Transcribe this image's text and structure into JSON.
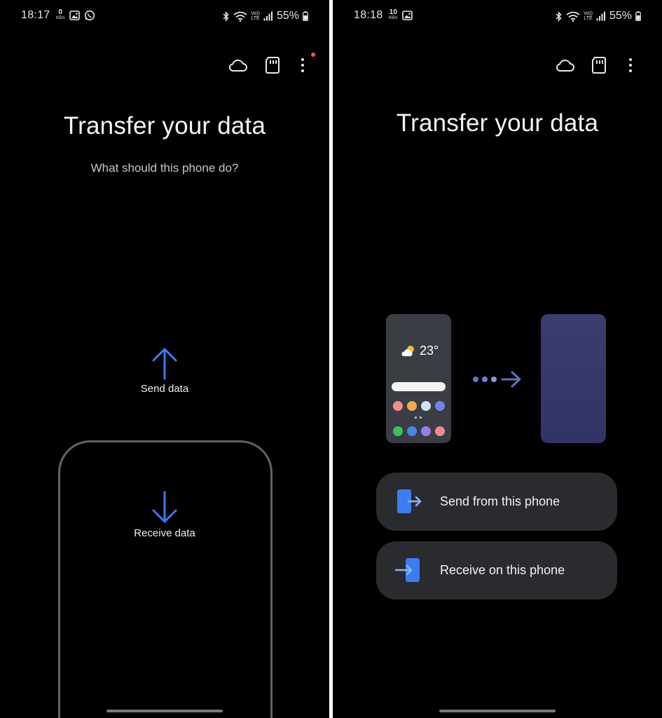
{
  "left_screen": {
    "status_bar": {
      "time": "18:17",
      "speed_value": "0",
      "speed_unit": "KB/s",
      "battery": "55%",
      "volte_top": "Vo))",
      "volte_bottom": "LTE"
    },
    "title": "Transfer your data",
    "subtitle": "What should this phone do?",
    "send_label": "Send data",
    "receive_label": "Receive data"
  },
  "right_screen": {
    "status_bar": {
      "time": "18:18",
      "speed_value": "10",
      "speed_unit": "KB/s",
      "battery": "55%",
      "volte_top": "Vo))",
      "volte_bottom": "LTE"
    },
    "title": "Transfer your data",
    "illustration": {
      "temperature": "23°"
    },
    "send_option": "Send from this phone",
    "receive_option": "Receive on this phone"
  },
  "colors": {
    "accent_blue": "#3d7cf0",
    "notification_dot": "#ff5a36",
    "card_bg": "#2a2b2f",
    "outline_gray": "#5e626a"
  },
  "icons": [
    "cloud-icon",
    "sd-card-icon",
    "more-vert-icon",
    "bluetooth-icon",
    "wifi-icon",
    "signal-icon",
    "battery-icon",
    "gallery-icon",
    "whatsapp-icon",
    "arrow-up-icon",
    "arrow-down-icon"
  ]
}
